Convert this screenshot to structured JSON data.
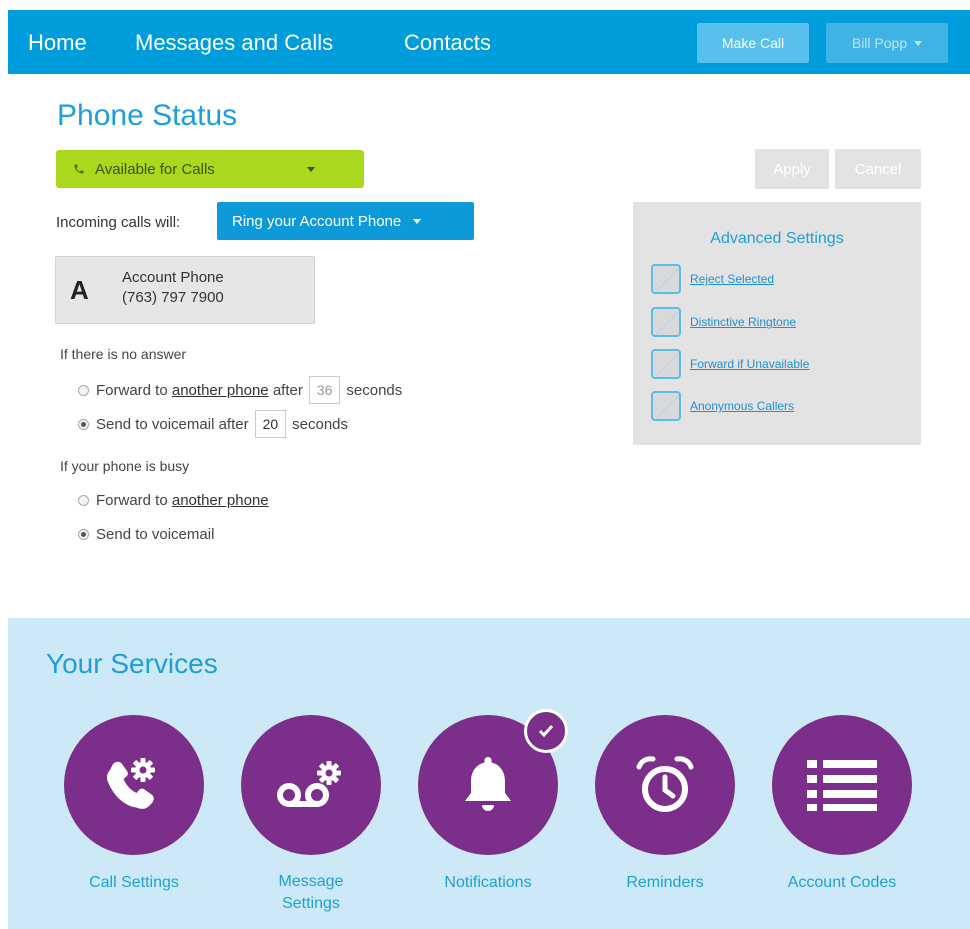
{
  "nav": {
    "home": "Home",
    "messages": "Messages and Calls",
    "contacts": "Contacts",
    "make_call": "Make Call",
    "user": "Bill Popp"
  },
  "page": {
    "title": "Phone Status"
  },
  "status": {
    "selected": "Available for Calls"
  },
  "incoming": {
    "label": "Incoming calls will:",
    "selected": "Ring your Account Phone"
  },
  "account_phone": {
    "letter": "A",
    "name": "Account Phone",
    "number": "(763) 797 7900"
  },
  "no_answer": {
    "label": "If there is no answer",
    "forward_prefix": "Forward to",
    "forward_link": "another phone",
    "forward_after": "after",
    "forward_seconds": "36",
    "seconds_label": "seconds",
    "voicemail_prefix": "Send to voicemail after",
    "voicemail_seconds": "20",
    "selected": "voicemail"
  },
  "busy": {
    "label": "If your phone is busy",
    "forward_prefix": "Forward to",
    "forward_link": "another phone",
    "voicemail": "Send to voicemail",
    "selected": "voicemail"
  },
  "actions": {
    "apply": "Apply",
    "cancel": "Cancel"
  },
  "advanced": {
    "title": "Advanced Settings",
    "items": [
      {
        "label": "Reject Selected"
      },
      {
        "label": "Distinctive Ringtone"
      },
      {
        "label": "Forward if Unavailable"
      },
      {
        "label": "Anonymous Callers"
      }
    ]
  },
  "services": {
    "title": "Your Services",
    "items": [
      {
        "label": "Call Settings",
        "icon": "phone-gear-icon"
      },
      {
        "label": "Message\nSettings",
        "icon": "voicemail-gear-icon"
      },
      {
        "label": "Notifications",
        "icon": "bell-icon",
        "checked": true
      },
      {
        "label": "Reminders",
        "icon": "alarm-clock-icon"
      },
      {
        "label": "Account Codes",
        "icon": "list-icon"
      }
    ]
  },
  "colors": {
    "nav": "#009ddc",
    "available": "#a9d81c",
    "service_circle": "#7b2f8b",
    "accent": "#1e9fdc",
    "services_bg": "#cde9f7"
  }
}
